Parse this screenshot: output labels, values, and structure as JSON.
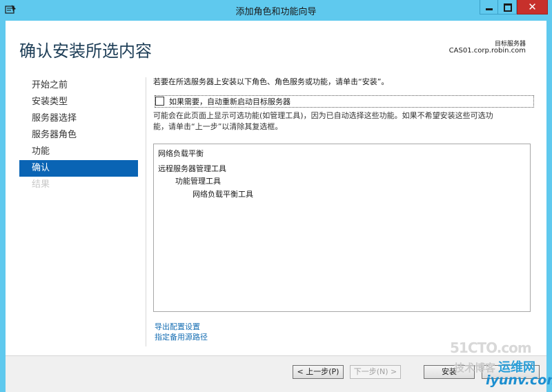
{
  "window": {
    "title": "添加角色和功能向导",
    "close_glyph": "✕"
  },
  "header": {
    "page_title": "确认安装所选内容",
    "server_label": "目标服务器",
    "server_name": "CAS01.corp.robin.com"
  },
  "nav": {
    "items": [
      {
        "label": "开始之前",
        "state": "normal"
      },
      {
        "label": "安装类型",
        "state": "normal"
      },
      {
        "label": "服务器选择",
        "state": "normal"
      },
      {
        "label": "服务器角色",
        "state": "normal"
      },
      {
        "label": "功能",
        "state": "normal"
      },
      {
        "label": "确认",
        "state": "active"
      },
      {
        "label": "结果",
        "state": "disabled"
      }
    ]
  },
  "main": {
    "instruction": "若要在所选服务器上安装以下角色、角色服务或功能，请单击“安装”。",
    "restart_checkbox_label": "如果需要，自动重新启动目标服务器",
    "restart_checked": false,
    "note_line1": "可能会在此页面上显示可选功能(如管理工具)，因为已自动选择这些功能。如果不希望安装这些可选功",
    "note_line2": "能，请单击“上一步”以清除其复选框。",
    "features": [
      {
        "label": "网络负载平衡",
        "level": 0
      },
      {
        "label": "远程服务器管理工具",
        "level": 0
      },
      {
        "label": "功能管理工具",
        "level": 1
      },
      {
        "label": "网络负载平衡工具",
        "level": 2
      }
    ],
    "links": {
      "export_config": "导出配置设置",
      "alternate_source": "指定备用源路径"
    }
  },
  "footer": {
    "prev_label": "< 上一步(P)",
    "next_label": "下一步(N) >",
    "install_label": "安装",
    "cancel_label": ""
  },
  "watermark": {
    "line1": "51CTO.com",
    "line2": "技术博客",
    "line3": "运维网",
    "line4": "iyunv.com"
  },
  "colors": {
    "chrome": "#5fc9ee",
    "accent": "#0a64b4",
    "close": "#c7302b",
    "title_text": "#1e3e57",
    "link": "#166eb3"
  }
}
